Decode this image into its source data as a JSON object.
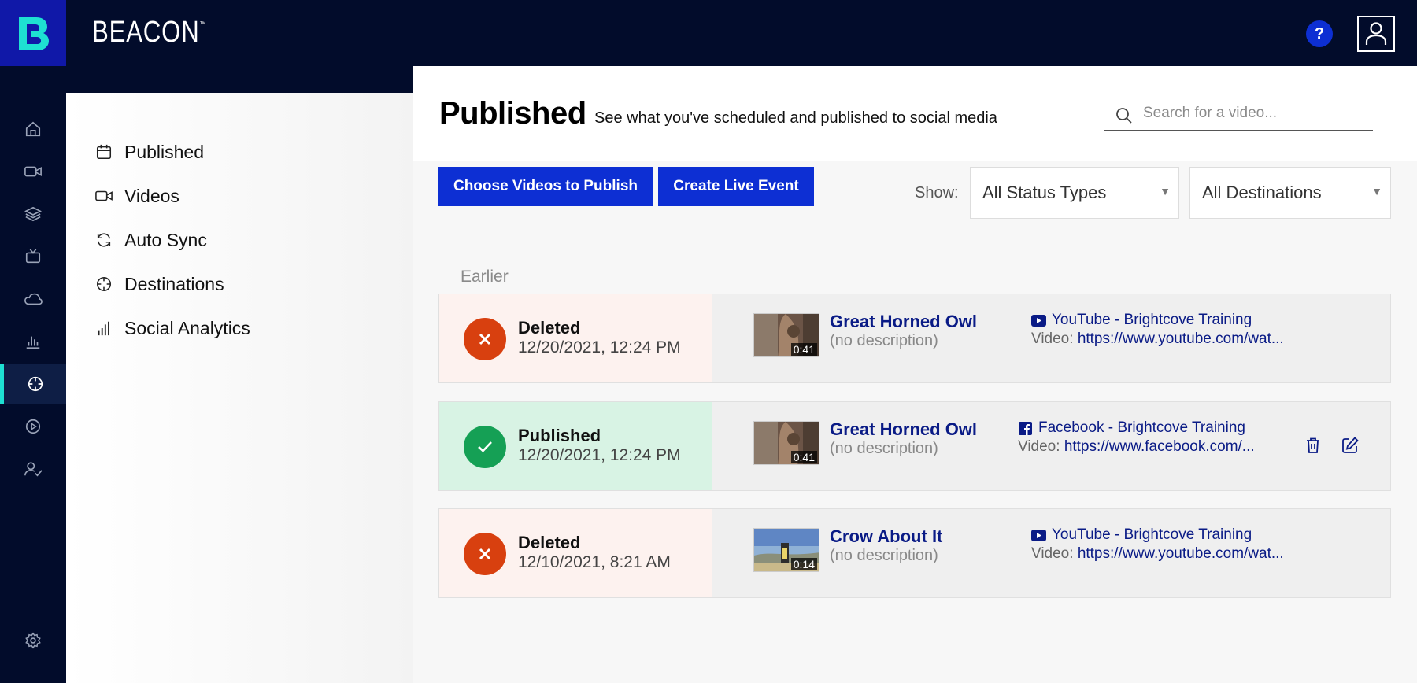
{
  "app": {
    "brand": "BEACON",
    "brand_mark": "™",
    "help_label": "?"
  },
  "rail": {
    "items": [
      {
        "icon": "home-icon"
      },
      {
        "icon": "video-camera-icon"
      },
      {
        "icon": "layers-icon"
      },
      {
        "icon": "tv-icon"
      },
      {
        "icon": "cloud-icon"
      },
      {
        "icon": "bar-chart-icon"
      },
      {
        "icon": "crosshair-icon",
        "active": true
      },
      {
        "icon": "play-circle-icon"
      },
      {
        "icon": "user-check-icon"
      }
    ],
    "settings_icon": "gear-icon"
  },
  "subnav": {
    "items": [
      {
        "label": "Published",
        "icon": "calendar-icon"
      },
      {
        "label": "Videos",
        "icon": "video-camera-icon"
      },
      {
        "label": "Auto Sync",
        "icon": "sync-icon"
      },
      {
        "label": "Destinations",
        "icon": "crosshair-icon"
      },
      {
        "label": "Social Analytics",
        "icon": "signal-bars-icon"
      }
    ]
  },
  "main": {
    "title": "Published",
    "subtitle": "See what you've scheduled and published to social media",
    "search_placeholder": "Search for a video...",
    "buttons": {
      "choose": "Choose Videos to Publish",
      "live": "Create Live Event"
    },
    "filters": {
      "show_label": "Show:",
      "status": "All Status Types",
      "destinations": "All Destinations"
    },
    "group_label": "Earlier",
    "rows": [
      {
        "status": "Deleted",
        "date": "12/20/2021, 12:24 PM",
        "duration": "0:41",
        "title": "Great Horned Owl",
        "description": "(no description)",
        "destination": "YouTube - Brightcove Training",
        "video_label": "Video:",
        "video_url": "https://www.youtube.com/wat..."
      },
      {
        "status": "Published",
        "date": "12/20/2021, 12:24 PM",
        "duration": "0:41",
        "title": "Great Horned Owl",
        "description": "(no description)",
        "destination": "Facebook - Brightcove Training",
        "video_label": "Video:",
        "video_url": "https://www.facebook.com/..."
      },
      {
        "status": "Deleted",
        "date": "12/10/2021, 8:21 AM",
        "duration": "0:14",
        "title": "Crow About It",
        "description": "(no description)",
        "destination": "YouTube - Brightcove Training",
        "video_label": "Video:",
        "video_url": "https://www.youtube.com/wat..."
      }
    ]
  },
  "colors": {
    "navy": "#020c2b",
    "brand_blue": "#0d2fd3",
    "accent_teal": "#1ee0d2",
    "deleted_red": "#d8400f",
    "published_green": "#15a055",
    "link_navy": "#0a1b86"
  }
}
